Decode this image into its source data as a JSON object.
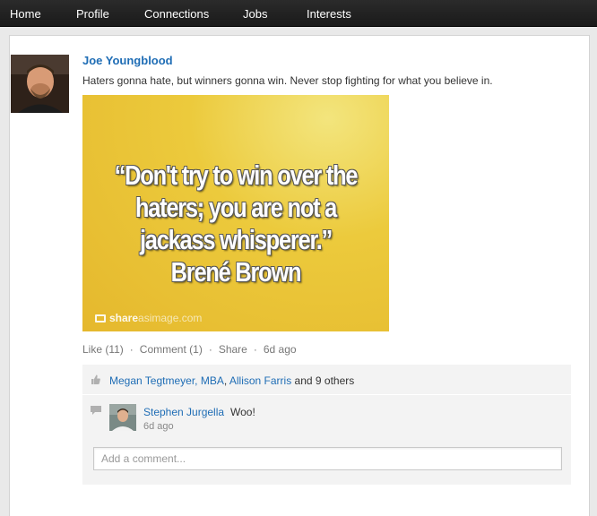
{
  "nav": {
    "items": [
      {
        "label": "Home"
      },
      {
        "label": "Profile"
      },
      {
        "label": "Connections"
      },
      {
        "label": "Jobs"
      },
      {
        "label": "Interests"
      }
    ]
  },
  "post": {
    "author": "Joe Youngblood",
    "text": "Haters gonna hate, but winners gonna win. Never stop fighting for what you believe in.",
    "image": {
      "quote_lines": [
        "“Don't try to win over the",
        "haters; you are not a",
        "jackass whisperer.”",
        "Brené Brown"
      ],
      "watermark_bold": "share",
      "watermark_light": "asimage.com"
    },
    "actions": {
      "like": "Like (11)",
      "comment": "Comment (1)",
      "share": "Share",
      "time": "6d ago",
      "separator": "·"
    },
    "likes": {
      "name1": "Megan Tegtmeyer, MBA",
      "sep": ", ",
      "name2": "Allison Farris",
      "suffix": " and 9 others"
    },
    "comments": [
      {
        "name": "Stephen Jurgella",
        "text": "Woo!",
        "time": "6d ago"
      }
    ],
    "comment_input": {
      "placeholder": "Add a comment..."
    }
  },
  "icons": {
    "like": "thumbs-up-icon",
    "comment": "speech-bubble-icon"
  },
  "colors": {
    "link": "#1f6db5",
    "navbar": "#222222",
    "image_yellow": "#ecca3c"
  }
}
